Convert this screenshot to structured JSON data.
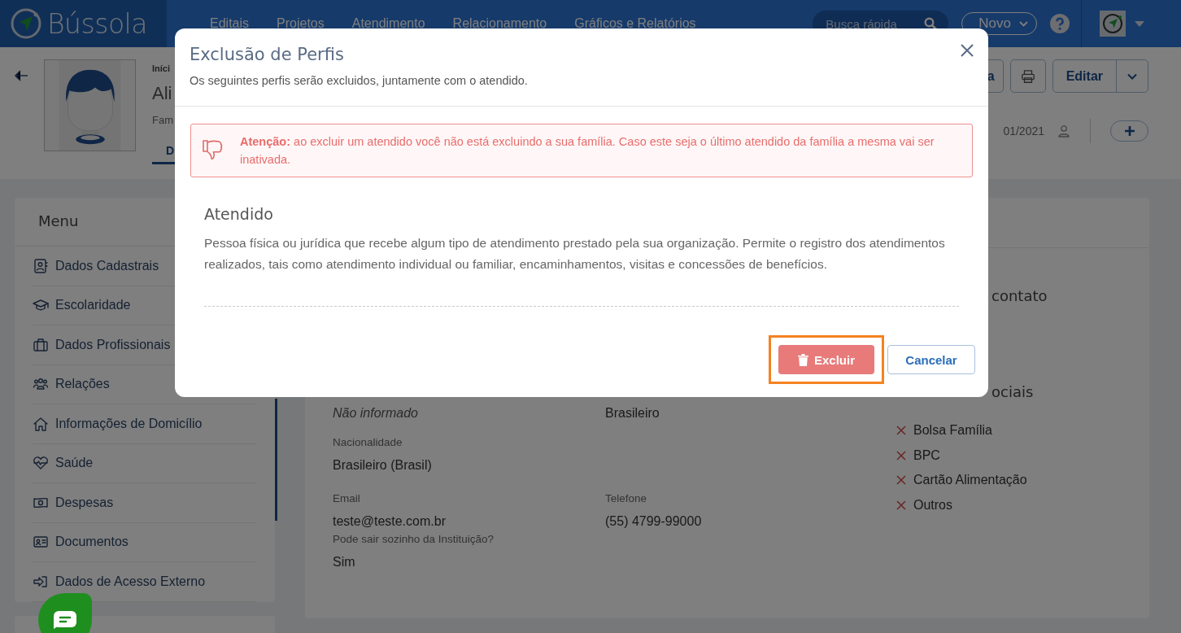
{
  "navbar": {
    "logo": "Bússola",
    "menu": [
      "Editais",
      "Projetos",
      "Atendimento",
      "Relacionamento",
      "Gráficos e Relatórios"
    ],
    "search": {
      "placeholder": "Busca rápida"
    },
    "new_button": "Novo"
  },
  "profile": {
    "breadcrumb": "Iníci",
    "name": "Ali",
    "family": "Fam",
    "tab": "D",
    "date": "01/2021",
    "cut_button": "a",
    "edit_button": "Editar"
  },
  "menu": {
    "title": "Menu",
    "items": [
      {
        "label": "Dados Cadastrais"
      },
      {
        "label": "Escolaridade"
      },
      {
        "label": "Dados Profissionais"
      },
      {
        "label": "Relações"
      },
      {
        "label": "Informações de Domicílio"
      },
      {
        "label": "Saúde"
      },
      {
        "label": "Despesas"
      },
      {
        "label": "Documentos"
      },
      {
        "label": "Dados de Acesso Externo"
      }
    ]
  },
  "details": {
    "rows": [
      [
        {
          "value": "Não informado",
          "missing": true
        },
        {
          "value": "Brasileiro",
          "missing": false
        }
      ],
      [
        {
          "label": "Nacionalidade",
          "value": "Brasileiro (Brasil)",
          "missing": false
        }
      ],
      [
        {
          "label": "Email",
          "value": "teste@teste.com.br",
          "missing": false
        },
        {
          "label": "Telefone",
          "value": "(55) 4799-99000",
          "missing": false
        }
      ],
      [
        {
          "label": "Pode sair sozinho da Instituição?",
          "value": "Sim",
          "missing": false
        }
      ]
    ],
    "contact_heading": "contato",
    "benefits_heading": "ociais",
    "benefits": [
      {
        "label": "Bolsa Família",
        "checked": false
      },
      {
        "label": "BPC",
        "checked": false
      },
      {
        "label": "Cartão Alimentação",
        "checked": false
      },
      {
        "label": "Outros",
        "checked": false
      }
    ]
  },
  "modal": {
    "title": "Exclusão de Perfis",
    "subtitle": "Os seguintes perfis serão excluidos, juntamente com o atendido.",
    "alert": "**Atenção:** ao excluir um atendido você não está excluindo a sua família. Caso este seja o último atendido da família a mesma vai ser inativada.",
    "section_title": "Atendido",
    "description": "Pessoa física ou jurídica que recebe algum tipo de atendimento prestado pela sua organização. Permite o registro dos atendimentos realizados, tais como atendimento individual ou familiar, encaminhamentos, visitas e concessões de benefícios.",
    "confirm_button": "Excluir",
    "confirm_highlighted": true,
    "cancel_button": "Cancelar"
  }
}
